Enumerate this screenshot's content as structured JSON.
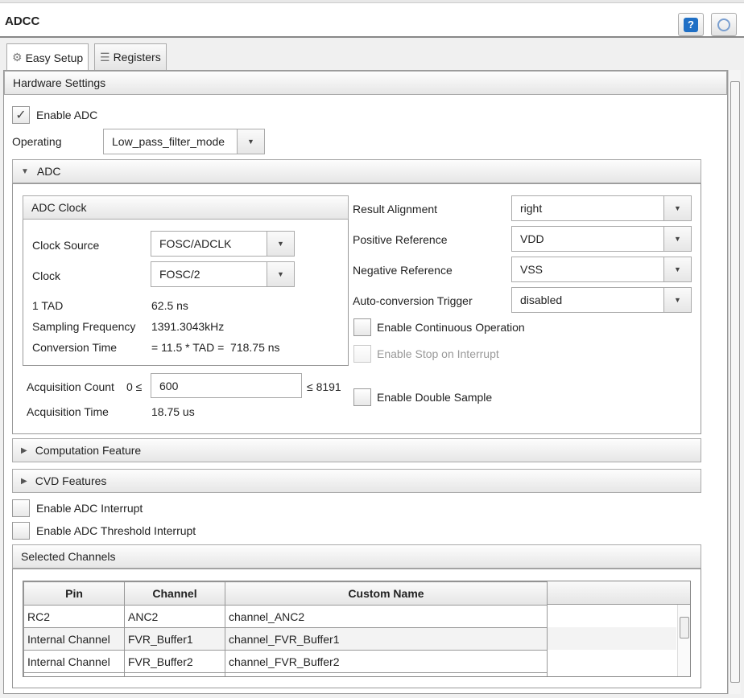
{
  "header": {
    "title": "ADCC",
    "help_icon": "help-icon",
    "globe_icon": "globe-icon"
  },
  "tabs": [
    {
      "label": "Easy Setup",
      "icon": "gear-icon"
    },
    {
      "label": "Registers",
      "icon": "registers-icon"
    }
  ],
  "hardware": {
    "title": "Hardware Settings",
    "enable_adc": "Enable ADC",
    "enable_adc_checked": true,
    "operating_label": "Operating",
    "operating_value": "Low_pass_filter_mode"
  },
  "adc": {
    "title": "ADC",
    "clock": {
      "title": "ADC Clock",
      "source_label": "Clock Source",
      "source_value": "FOSC/ADCLK",
      "clock_label": "Clock",
      "clock_value": "FOSC/2",
      "tad_label": "1 TAD",
      "tad_value": "62.5 ns",
      "samp_label": "Sampling Frequency",
      "samp_value": "1391.3043kHz",
      "conv_label": "Conversion Time",
      "conv_value": "= 11.5 * TAD =  718.75 ns"
    },
    "acq_count_label": "Acquisition Count",
    "acq_min": "0 ≤",
    "acq_value": "600",
    "acq_max": "≤ 8191",
    "acq_time_label": "Acquisition Time",
    "acq_time_value": "18.75 us",
    "result_align_label": "Result Alignment",
    "result_align_value": "right",
    "pos_ref_label": "Positive Reference",
    "pos_ref_value": "VDD",
    "neg_ref_label": "Negative Reference",
    "neg_ref_value": "VSS",
    "trigger_label": "Auto-conversion Trigger",
    "trigger_value": "disabled",
    "continuous": "Enable Continuous Operation",
    "stop_int": "Enable Stop on Interrupt",
    "double_sample": "Enable Double Sample"
  },
  "computation": "Computation Feature",
  "cvd": "CVD Features",
  "adc_interrupt": "Enable ADC Interrupt",
  "threshold_interrupt": "Enable ADC Threshold Interrupt",
  "channels": {
    "title": "Selected Channels",
    "headers": [
      "Pin",
      "Channel",
      "Custom Name",
      ""
    ],
    "rows": [
      [
        "RC2",
        "ANC2",
        "channel_ANC2"
      ],
      [
        "Internal Channel",
        "FVR_Buffer1",
        "channel_FVR_Buffer1"
      ],
      [
        "Internal Channel",
        "FVR_Buffer2",
        "channel_FVR_Buffer2"
      ]
    ]
  }
}
